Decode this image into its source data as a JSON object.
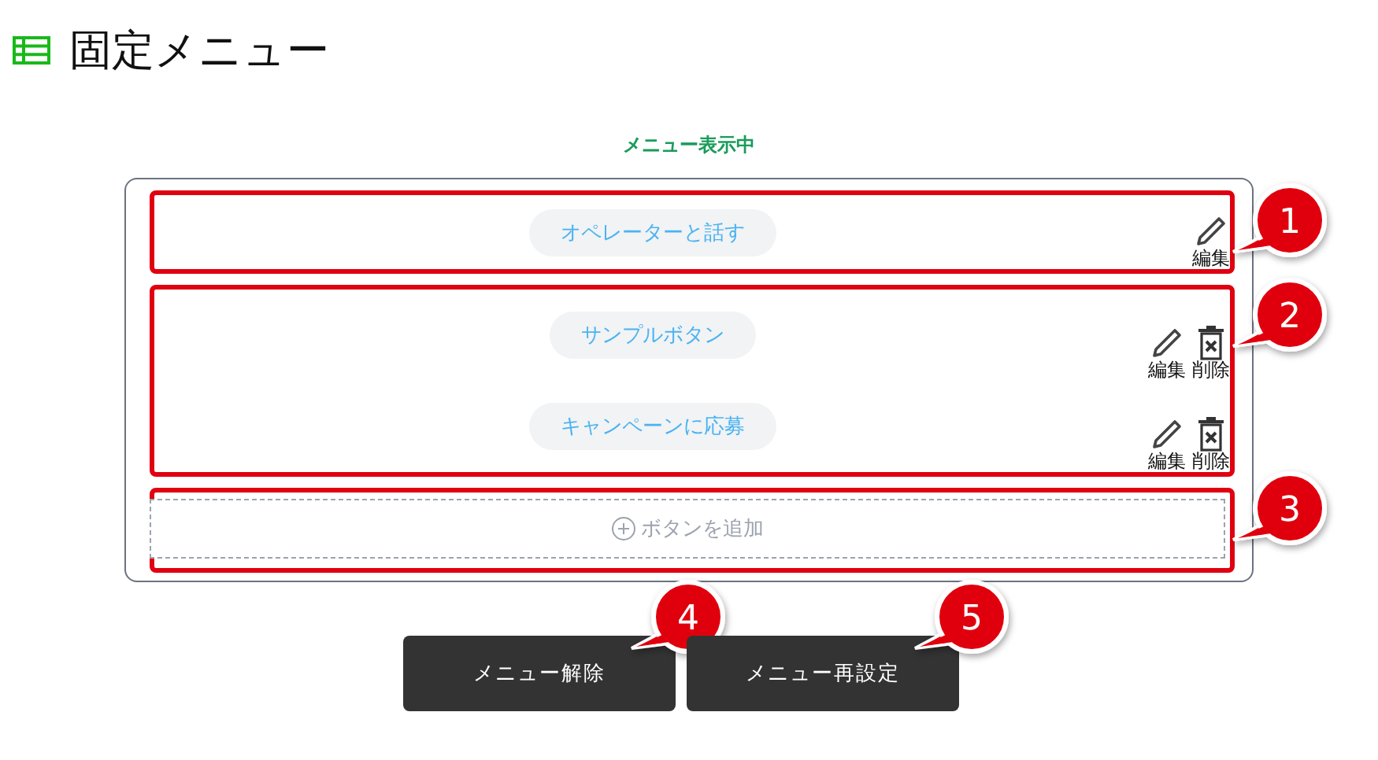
{
  "page": {
    "title": "固定メニュー"
  },
  "status": "メニュー表示中",
  "sections": [
    {
      "callout": "1",
      "rows": [
        {
          "label": "オペレーターと話す",
          "actions": [
            {
              "kind": "edit",
              "label": "編集"
            }
          ]
        }
      ]
    },
    {
      "callout": "2",
      "rows": [
        {
          "label": "サンプルボタン",
          "actions": [
            {
              "kind": "edit",
              "label": "編集"
            },
            {
              "kind": "delete",
              "label": "削除"
            }
          ]
        },
        {
          "label": "キャンペーンに応募",
          "actions": [
            {
              "kind": "edit",
              "label": "編集"
            },
            {
              "kind": "delete",
              "label": "削除"
            }
          ]
        }
      ]
    }
  ],
  "add_section": {
    "callout": "3",
    "label": "ボタンを追加"
  },
  "buttons": [
    {
      "label": "メニュー解除",
      "callout": "4"
    },
    {
      "label": "メニュー再設定",
      "callout": "5"
    }
  ]
}
